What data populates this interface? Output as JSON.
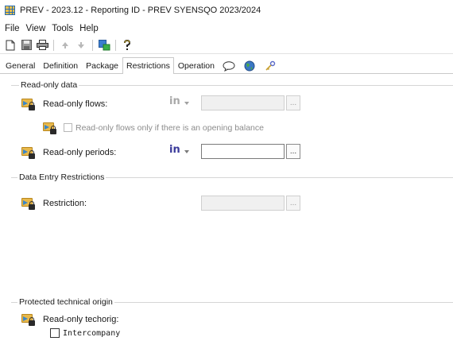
{
  "window": {
    "title": "PREV - 2023.12 - Reporting ID - PREV SYENSQO 2023/2024"
  },
  "menu": {
    "items": [
      "File",
      "View",
      "Tools",
      "Help"
    ]
  },
  "toolbar": {
    "buttons": [
      "new-icon",
      "save-icon",
      "print-icon",
      "back-arrow-icon",
      "forward-arrow-icon",
      "refresh-icon",
      "help-icon"
    ]
  },
  "tabs": {
    "items": [
      "General",
      "Definition",
      "Package",
      "Restrictions",
      "Operation"
    ],
    "icon_tabs": [
      "speech-bubble-icon",
      "globe-icon",
      "key-icon"
    ],
    "active": "Restrictions"
  },
  "read_only_data": {
    "title": "Read-only data",
    "flows": {
      "label": "Read-only flows:",
      "operator": "in",
      "enabled": false,
      "value": "",
      "browse": "..."
    },
    "opening_balance": {
      "label": "Read-only flows only if there is an opening balance",
      "checked": false,
      "enabled": false
    },
    "periods": {
      "label": "Read-only periods:",
      "operator": "in",
      "enabled": true,
      "value": "",
      "browse": "..."
    }
  },
  "data_entry_restrictions": {
    "title": "Data Entry Restrictions",
    "restriction": {
      "label": "Restriction:",
      "value": "",
      "browse": "...",
      "enabled": false
    }
  },
  "protected_technical_origin": {
    "title": "Protected technical origin",
    "techorig": {
      "label": "Read-only techorig:"
    },
    "intercompany": {
      "label": "Intercompany",
      "checked": false
    }
  },
  "colors": {
    "operator_enabled": "#3a3a9a",
    "operator_disabled": "#a8a8a8",
    "folder": "#e8b84a",
    "arrow": "#3a86c8"
  }
}
